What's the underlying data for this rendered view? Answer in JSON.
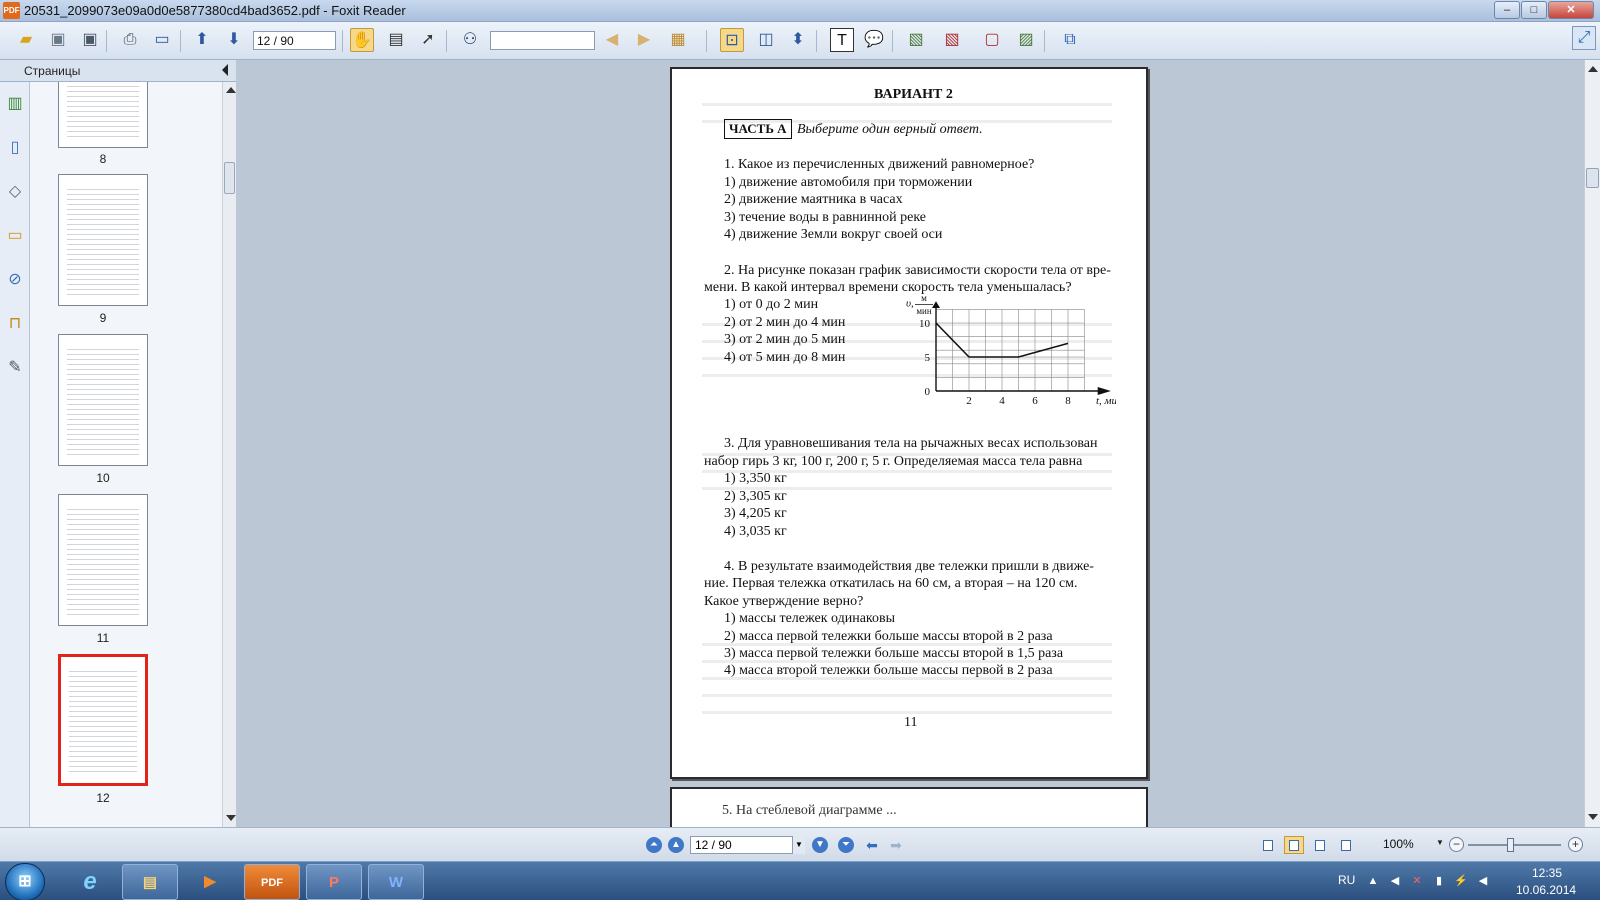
{
  "window": {
    "title": "20531_2099073e09a0d0e5877380cd4bad3652.pdf - Foxit Reader",
    "app_icon_text": "PDF",
    "minimize_glyph": "‒",
    "maximize_glyph": "□",
    "close_glyph": "✕"
  },
  "toolbar": {
    "page_field_value": "12 / 90",
    "find_placeholder": "",
    "icons": [
      "open-folder-icon",
      "save-icon",
      "save-all-icon",
      "print-icon",
      "email-icon",
      "prev-page-icon",
      "next-page-icon",
      "hand-tool-icon",
      "text-select-icon",
      "select-arrow-icon",
      "find-binoculars-icon",
      "prev-find-icon",
      "next-find-icon",
      "page-setup-icon",
      "fit-page-icon",
      "fit-width-icon",
      "fit-visible-icon",
      "typewriter-icon",
      "comment-icon",
      "pdf-create-icon",
      "pdf-convert-icon",
      "pdf-export-icon",
      "pdf-merge-icon",
      "window-switch-icon"
    ]
  },
  "sidebar": {
    "panel_title": "Страницы",
    "thumbnails": [
      {
        "label": "8"
      },
      {
        "label": "9"
      },
      {
        "label": "10"
      },
      {
        "label": "11"
      },
      {
        "label": "12"
      }
    ]
  },
  "document": {
    "variant": "ВАРИАНТ 2",
    "part_label": "ЧАСТЬ А",
    "part_instruction": "Выберите один верный ответ.",
    "q1": {
      "text": "1. Какое из перечисленных движений равномерное?",
      "options": [
        "1) движение автомобиля при торможении",
        "2) движение маятника в часах",
        "3) течение воды в равнинной реке",
        "4) движение Земли вокруг своей оси"
      ]
    },
    "q2": {
      "line1": "2. На рисунке показан график зависимости скорости тела от вре-",
      "line2": "мени. В какой интервал времени скорость тела уменьшалась?",
      "options": [
        "1) от 0 до 2 мин",
        "2) от 2 мин до 4 мин",
        "3) от 2 мин до 5 мин",
        "4) от 5 мин до 8 мин"
      ]
    },
    "q3": {
      "line1": "3. Для уравновешивания тела на рычажных весах использован",
      "line2": "набор гирь 3 кг, 100 г, 200 г, 5 г. Определяемая масса тела равна",
      "options": [
        "1) 3,350 кг",
        "2) 3,305 кг",
        "3) 4,205 кг",
        "4) 3,035 кг"
      ]
    },
    "q4": {
      "line1": "4. В результате взаимодействия две тележки пришли в движе-",
      "line2": "ние. Первая тележка откатилась на 60 см, а вторая – на 120 см.",
      "line3": "Какое утверждение верно?",
      "options": [
        "1) массы тележек одинаковы",
        "2) масса первой тележки больше массы второй в 2 раза",
        "3) масса первой тележки больше массы второй в 1,5 раза",
        "4) масса второй тележки больше массы первой в 2 раза"
      ]
    },
    "page_number": "11",
    "next_page_peek": "5. На стеблевой диаграмме ... "
  },
  "chart_data": {
    "type": "line",
    "ylabel_symbol": "υ,",
    "ylabel_unit_top": "м",
    "ylabel_unit_bottom": "мин",
    "xlabel": "t, мин",
    "x_ticks": [
      "2",
      "4",
      "6",
      "8"
    ],
    "y_ticks": [
      "0",
      "5",
      "10"
    ],
    "xlim": [
      0,
      10
    ],
    "ylim": [
      0,
      12
    ],
    "grid": true,
    "series": [
      {
        "x": [
          0,
          2,
          5,
          8
        ],
        "values": [
          10,
          5,
          5,
          7
        ]
      }
    ]
  },
  "statusbar": {
    "page_field_value": "12 / 90",
    "zoom": "100%",
    "zoom_level": 0.45
  },
  "taskbar": {
    "start_glyph": "⊞",
    "apps": [
      {
        "name": "internet-explorer-icon",
        "glyph": "e"
      },
      {
        "name": "file-explorer-icon",
        "glyph": "▤"
      },
      {
        "name": "media-player-icon",
        "glyph": "▶"
      },
      {
        "name": "foxit-reader-icon",
        "glyph": "PDF"
      },
      {
        "name": "powerpoint-icon",
        "glyph": "P"
      },
      {
        "name": "word-icon",
        "glyph": "W"
      }
    ],
    "language": "RU",
    "time": "12:35",
    "date": "10.06.2014"
  }
}
